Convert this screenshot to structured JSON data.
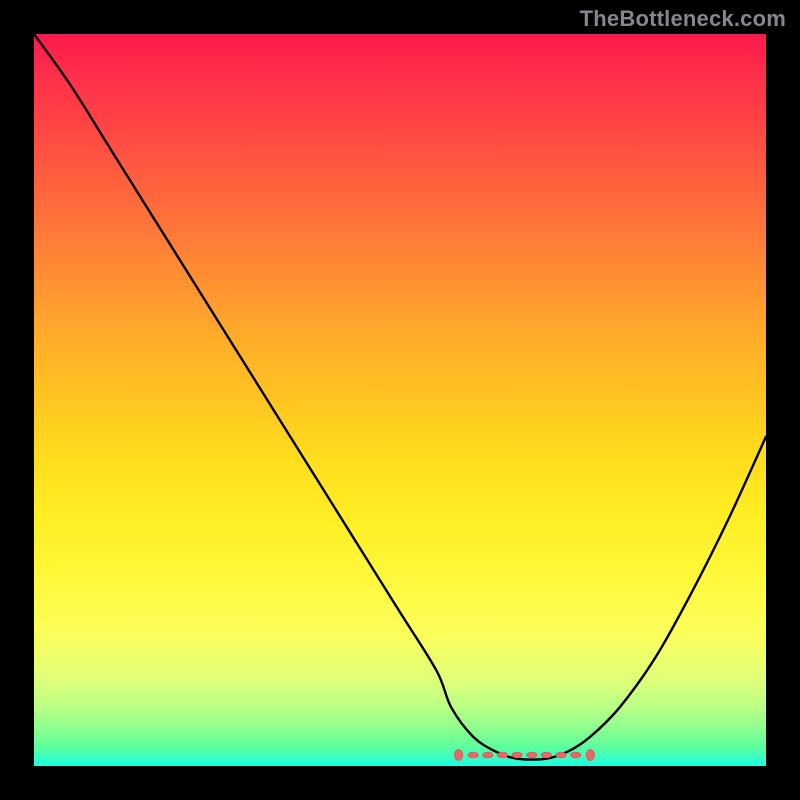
{
  "watermark": "TheBottleneck.com",
  "colors": {
    "frame": "#000000",
    "curve": "#000000",
    "marker_fill": "#e46a6a",
    "marker_stroke": "#d85858"
  },
  "chart_data": {
    "type": "line",
    "title": "",
    "xlabel": "",
    "ylabel": "",
    "xlim": [
      0,
      100
    ],
    "ylim": [
      0,
      100
    ],
    "grid": false,
    "legend": false,
    "note": "Axes are unlabeled; values are normalized estimates read from the rendered image. y=0 is the bottom (green) and y=100 is the top (red).",
    "series": [
      {
        "name": "bottleneck-curve",
        "x": [
          0,
          5,
          10,
          15,
          20,
          25,
          30,
          35,
          40,
          45,
          50,
          55,
          57,
          60,
          63,
          66,
          70,
          73,
          76,
          80,
          85,
          90,
          95,
          100
        ],
        "y": [
          100,
          93,
          85,
          77,
          69,
          61,
          53,
          45,
          37,
          29,
          21,
          13,
          8,
          4,
          2,
          1,
          1,
          2,
          4,
          8,
          15,
          24,
          34,
          45
        ]
      }
    ],
    "optimal_band": {
      "description": "Flat minimum region near bottom marked with salmon dots/dashes",
      "x_start": 58,
      "x_end": 76,
      "y": 1.5,
      "markers_x": [
        58,
        60,
        62,
        64,
        66,
        68,
        70,
        72,
        74,
        76
      ]
    },
    "background_gradient": {
      "orientation": "vertical",
      "stops": [
        {
          "pos": 0.0,
          "color": "#ff1a4d"
        },
        {
          "pos": 0.5,
          "color": "#ffc522"
        },
        {
          "pos": 0.82,
          "color": "#fbff5b"
        },
        {
          "pos": 1.0,
          "color": "#1cffe1"
        }
      ]
    }
  }
}
